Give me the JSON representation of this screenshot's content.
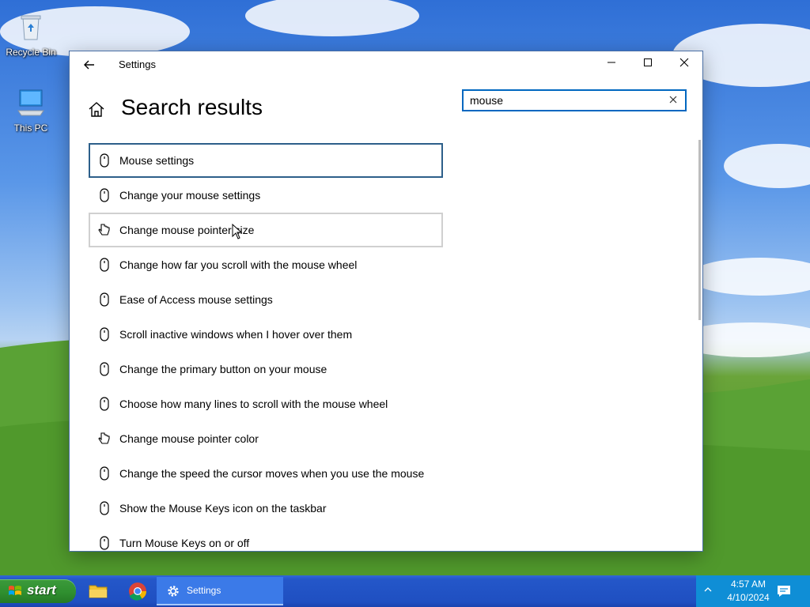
{
  "desktop": {
    "icons": [
      {
        "label": "Recycle Bin"
      },
      {
        "label": "This PC"
      }
    ]
  },
  "window": {
    "title": "Settings",
    "back_icon": "back-arrow-icon",
    "controls": {
      "minimize": "minimize-icon",
      "maximize": "maximize-icon",
      "close": "close-icon"
    }
  },
  "page": {
    "title": "Search results",
    "home_icon": "home-icon"
  },
  "search": {
    "value": "mouse",
    "placeholder": ""
  },
  "results": [
    {
      "label": "Mouse settings",
      "icon": "mouse-icon",
      "state": "focused"
    },
    {
      "label": "Change your mouse settings",
      "icon": "mouse-icon",
      "state": ""
    },
    {
      "label": "Change mouse pointer size",
      "icon": "pointer-hand-icon",
      "state": "hovered"
    },
    {
      "label": "Change how far you scroll with the mouse wheel",
      "icon": "mouse-icon",
      "state": ""
    },
    {
      "label": "Ease of Access mouse settings",
      "icon": "mouse-icon",
      "state": ""
    },
    {
      "label": "Scroll inactive windows when I hover over them",
      "icon": "mouse-icon",
      "state": ""
    },
    {
      "label": "Change the primary button on your mouse",
      "icon": "mouse-icon",
      "state": ""
    },
    {
      "label": "Choose how many lines to scroll with the mouse wheel",
      "icon": "mouse-icon",
      "state": ""
    },
    {
      "label": "Change mouse pointer color",
      "icon": "pointer-hand-icon",
      "state": ""
    },
    {
      "label": "Change the speed the cursor moves when you use the mouse",
      "icon": "mouse-icon",
      "state": ""
    },
    {
      "label": "Show the Mouse Keys icon on the taskbar",
      "icon": "mouse-icon",
      "state": ""
    },
    {
      "label": "Turn Mouse Keys on or off",
      "icon": "mouse-icon",
      "state": ""
    }
  ],
  "taskbar": {
    "start_label": "start",
    "apps": [
      {
        "name": "file-explorer-icon"
      },
      {
        "name": "chrome-icon"
      }
    ],
    "active_app": {
      "label": "Settings",
      "icon": "gear-icon"
    },
    "tray": {
      "time": "4:57 AM",
      "date": "4/10/2024"
    }
  },
  "colors": {
    "focus_border": "#2d5f8a",
    "search_border": "#0067c0",
    "taskbar": "#2457c9",
    "tray": "#0f8ed6",
    "start_button": "#2f8f2f"
  }
}
